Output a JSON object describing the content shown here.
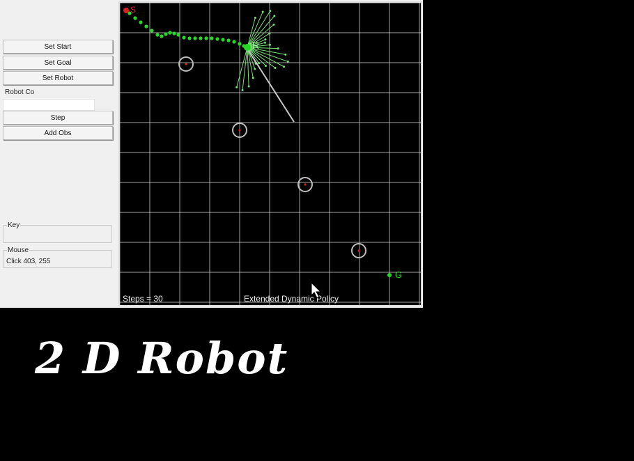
{
  "controls": {
    "set_start": "Set Start",
    "set_goal": "Set Goal",
    "set_robot": "Set Robot",
    "robot_co_label": "Robot Co",
    "robot_co_value": "",
    "step": "Step",
    "add_obs": "Add Obs"
  },
  "key_group": {
    "title": "Key",
    "value": ""
  },
  "mouse_group": {
    "title": "Mouse",
    "value": "Click 403, 255"
  },
  "canvas": {
    "steps_text": "Steps = 30",
    "policy_text": "Extended Dynamic Policy",
    "start_marker_label": "S",
    "goal_marker_label": "G",
    "robot_marker_label": "R",
    "colors": {
      "background": "#000000",
      "grid": "#d8d8d8",
      "path": "#28d828",
      "rays": "#7be07b",
      "obstacle": "#bdbdbd",
      "obstacle_center": "#d02020",
      "start": "#e02020",
      "heading": "#c8c8c8"
    }
  },
  "overlay_title": "2 D Robot",
  "cursor_icon": "mouse-pointer-icon"
}
